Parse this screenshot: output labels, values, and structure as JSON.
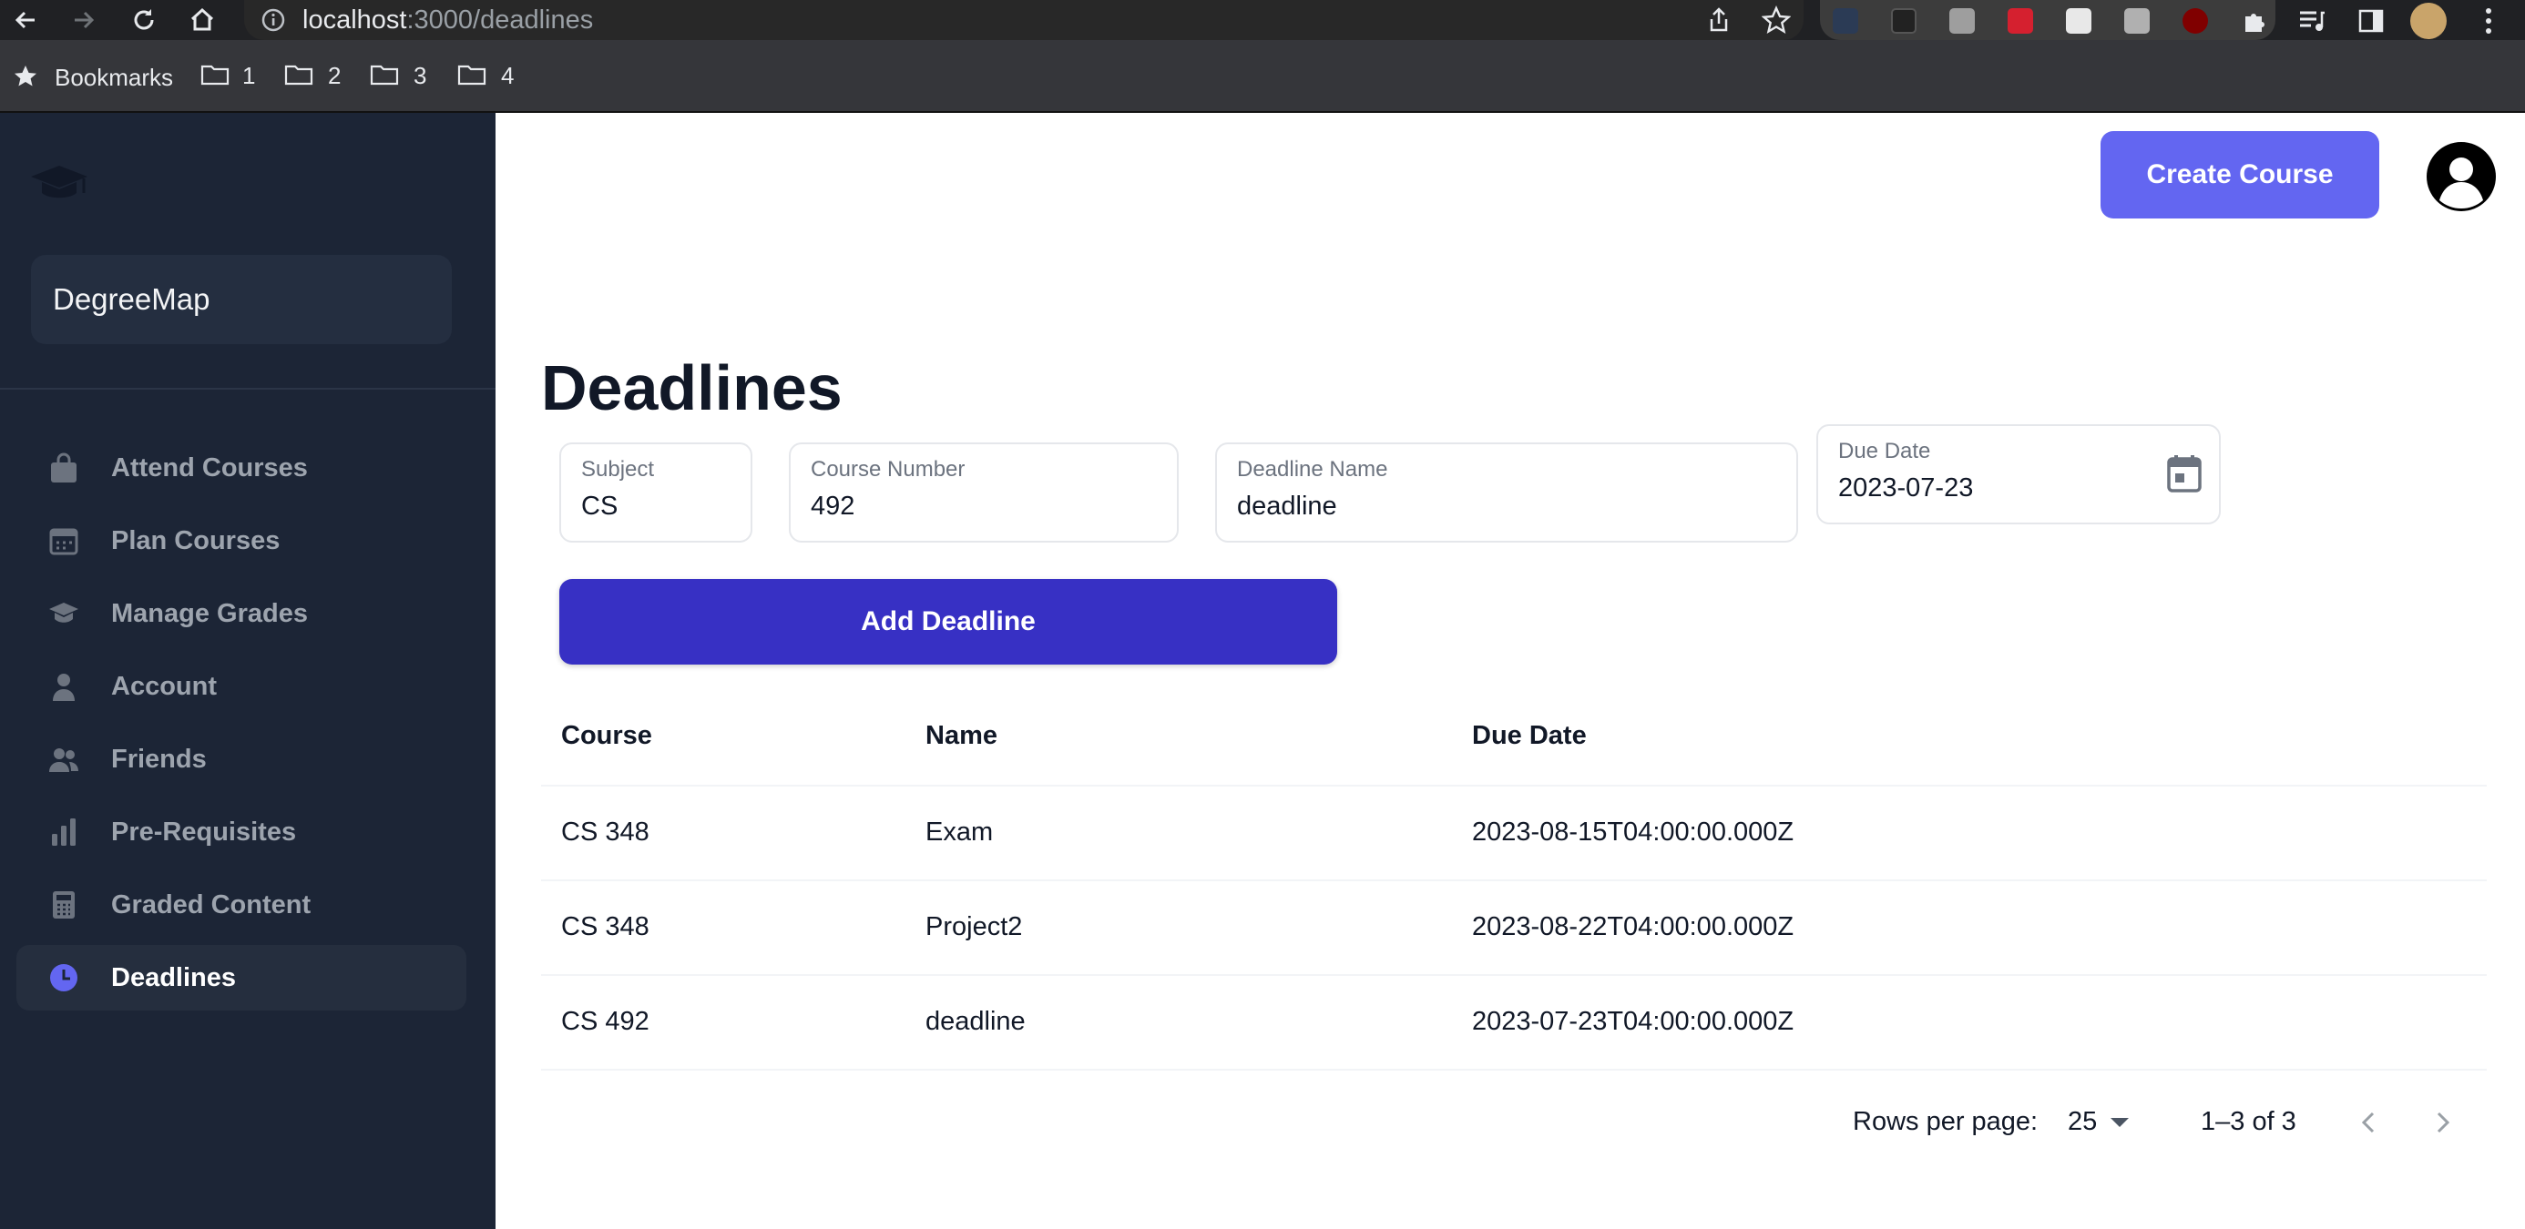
{
  "browser": {
    "url_host": "localhost",
    "url_path": ":3000/deadlines",
    "bookmarks_label": "Bookmarks",
    "folders": [
      "1",
      "2",
      "3",
      "4"
    ]
  },
  "sidebar": {
    "brand": "DegreeMap",
    "items": [
      {
        "label": "Attend Courses",
        "icon": "shopping-bag-icon"
      },
      {
        "label": "Plan Courses",
        "icon": "calendar-icon"
      },
      {
        "label": "Manage Grades",
        "icon": "graduation-cap-icon"
      },
      {
        "label": "Account",
        "icon": "user-icon"
      },
      {
        "label": "Friends",
        "icon": "users-icon"
      },
      {
        "label": "Pre-Requisites",
        "icon": "bar-chart-icon"
      },
      {
        "label": "Graded Content",
        "icon": "calculator-icon"
      },
      {
        "label": "Deadlines",
        "icon": "clock-icon",
        "active": true
      }
    ]
  },
  "header": {
    "create_course_label": "Create Course"
  },
  "main": {
    "title": "Deadlines",
    "form": {
      "subject": {
        "label": "Subject",
        "value": "CS"
      },
      "course_number": {
        "label": "Course Number",
        "value": "492"
      },
      "deadline_name": {
        "label": "Deadline Name",
        "value": "deadline"
      },
      "due_date": {
        "label": "Due Date",
        "value": "2023-07-23"
      }
    },
    "add_button_label": "Add Deadline",
    "table": {
      "headers": [
        "Course",
        "Name",
        "Due Date"
      ],
      "rows": [
        [
          "CS 348",
          "Exam",
          "2023-08-15T04:00:00.000Z"
        ],
        [
          "CS 348",
          "Project2",
          "2023-08-22T04:00:00.000Z"
        ],
        [
          "CS 492",
          "deadline",
          "2023-07-23T04:00:00.000Z"
        ]
      ]
    },
    "pagination": {
      "rows_per_page_label": "Rows per page:",
      "rows_per_page_value": "25",
      "range": "1–3 of 3"
    }
  },
  "colors": {
    "sidebar_bg": "#1c2536",
    "accent": "#6366f1",
    "add_button": "#3730c4"
  }
}
